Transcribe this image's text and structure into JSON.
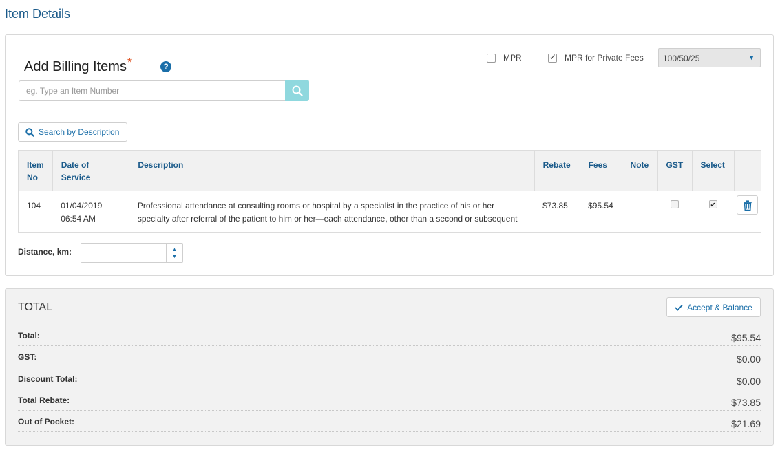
{
  "page_title": "Item Details",
  "billing": {
    "title": "Add Billing Items",
    "required_mark": "*",
    "help_glyph": "?",
    "search_placeholder": "eg. Type an Item Number",
    "desc_search_label": "Search by Description",
    "mpr_label": "MPR",
    "mpr_checked": false,
    "mpr_private_label": "MPR for Private Fees",
    "mpr_private_checked": true,
    "fee_schedule_value": "100/50/25"
  },
  "table": {
    "headers": {
      "item_no": "Item No",
      "date": "Date of Service",
      "description": "Description",
      "rebate": "Rebate",
      "fees": "Fees",
      "note": "Note",
      "gst": "GST",
      "select": "Select"
    },
    "rows": [
      {
        "item_no": "104",
        "date": "01/04/2019",
        "time": "06:54 AM",
        "description": "Professional attendance at consulting rooms or hospital by a specialist in the practice of his or her specialty after referral of the patient to him or her—each attendance, other than a second or subsequent attendance, in",
        "rebate": "$73.85",
        "fees": "$95.54",
        "note": "",
        "gst_checked": false,
        "select_checked": true
      }
    ]
  },
  "distance": {
    "label": "Distance, km:",
    "value": ""
  },
  "totals": {
    "title": "TOTAL",
    "accept_label": "Accept & Balance",
    "rows": [
      {
        "label": "Total:",
        "value": "$95.54"
      },
      {
        "label": "GST:",
        "value": "$0.00"
      },
      {
        "label": "Discount Total:",
        "value": "$0.00"
      },
      {
        "label": "Total Rebate:",
        "value": "$73.85"
      },
      {
        "label": "Out of Pocket:",
        "value": "$21.69"
      }
    ]
  },
  "colors": {
    "accent": "#1a6ea8",
    "search_button": "#8fd8de",
    "required": "#e05a2b"
  }
}
